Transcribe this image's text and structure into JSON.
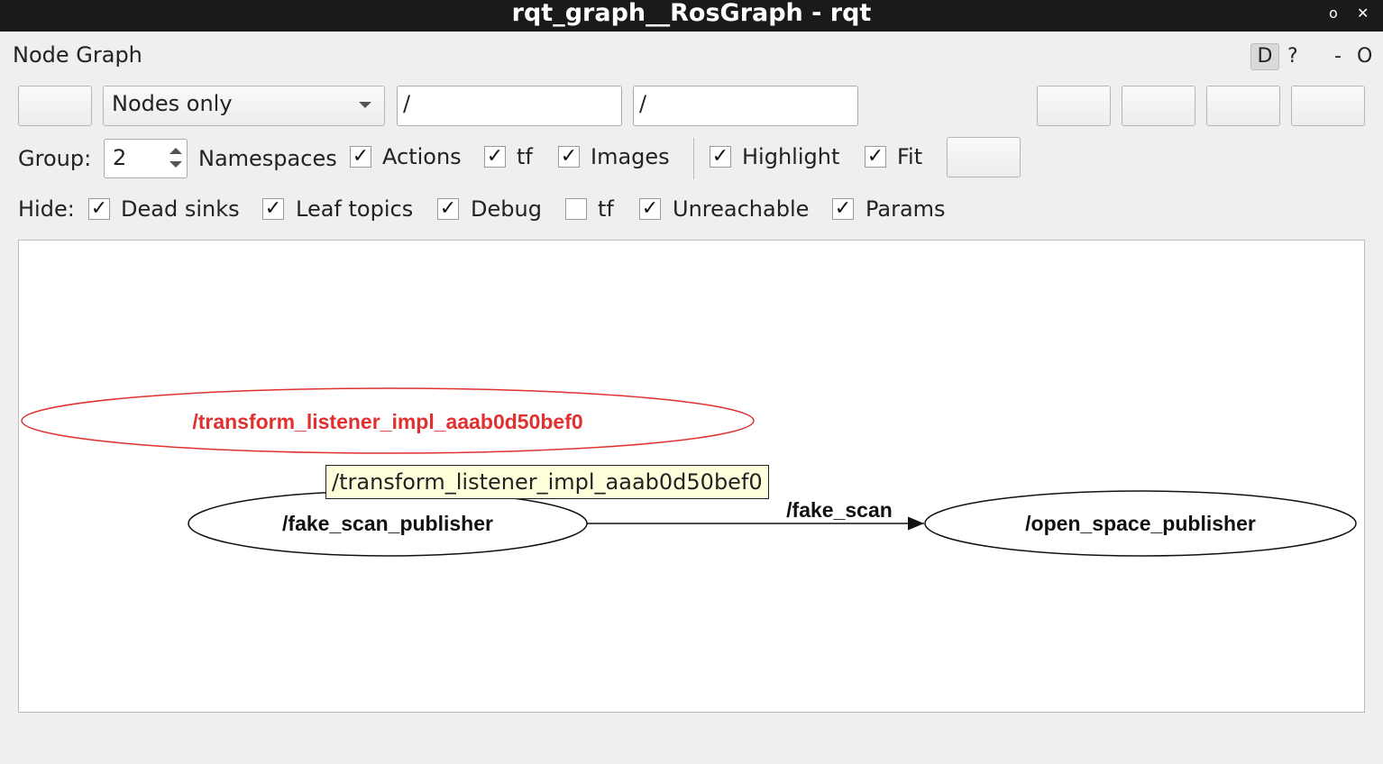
{
  "window": {
    "title": "rqt_graph__RosGraph - rqt",
    "float_glyph": "o",
    "close_glyph": "✕"
  },
  "plugin": {
    "title": "Node Graph",
    "d_button": "D",
    "help_button": "?",
    "minimize_button": "-",
    "options_button": "O"
  },
  "toolbar": {
    "graph_type_selected": "Nodes only",
    "node_filter_value": "/",
    "topic_filter_value": "/"
  },
  "options_row": {
    "group_label": "Group:",
    "group_value": "2",
    "namespaces_label": "Namespaces",
    "actions": {
      "label": "Actions",
      "checked": true
    },
    "tf": {
      "label": "tf",
      "checked": true
    },
    "images": {
      "label": "Images",
      "checked": true
    },
    "highlight": {
      "label": "Highlight",
      "checked": true
    },
    "fit": {
      "label": "Fit",
      "checked": true
    }
  },
  "hide_row": {
    "hide_label": "Hide:",
    "dead_sinks": {
      "label": "Dead sinks",
      "checked": true
    },
    "leaf_topics": {
      "label": "Leaf topics",
      "checked": true
    },
    "debug": {
      "label": "Debug",
      "checked": true
    },
    "tf": {
      "label": "tf",
      "checked": false
    },
    "unreachable": {
      "label": "Unreachable",
      "checked": true
    },
    "params": {
      "label": "Params",
      "checked": true
    }
  },
  "check_glyph": "✓",
  "graph": {
    "highlighted_node": "/transform_listener_impl_aaab0d50bef0",
    "node_a": "/fake_scan_publisher",
    "node_b": "/open_space_publisher",
    "edge_label": "/fake_scan",
    "tooltip": "/transform_listener_impl_aaab0d50bef0",
    "colors": {
      "highlight": "#e03030",
      "normal": "#111111",
      "tooltip_bg": "#ffffdc"
    }
  }
}
